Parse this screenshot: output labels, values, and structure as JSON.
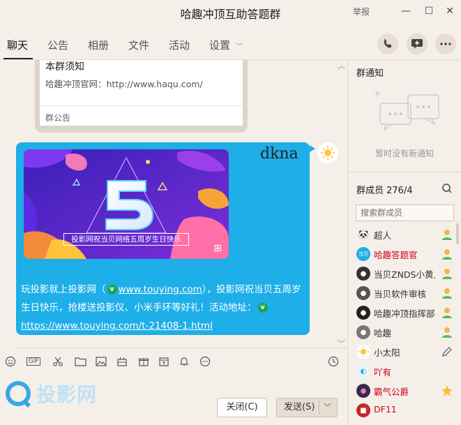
{
  "window": {
    "title": "哈趣冲顶互助答题群",
    "report_label": "举报",
    "minimize": "—",
    "maximize": "☐",
    "close": "✕"
  },
  "tabs": [
    {
      "label": "聊天",
      "active": true
    },
    {
      "label": "公告"
    },
    {
      "label": "相册"
    },
    {
      "label": "文件"
    },
    {
      "label": "活动"
    },
    {
      "label": "设置"
    }
  ],
  "header_actions": [
    "phone-icon",
    "add-chat-icon",
    "more-icon"
  ],
  "chat": {
    "notice_card": {
      "title": "本群须知",
      "line": "哈趣冲顶官网：http://www.haqu.com/",
      "footer": "群公告"
    },
    "message": {
      "sender": "dkna",
      "banner_caption": "投影网祝当贝网络五周岁生日快乐",
      "text_prefix": "玩投影就上投影网（",
      "link1": "www.touying.com",
      "text_middle": "），投影网祝当贝五周岁生日快乐，抢楼送投影仪、小米手环等好礼！活动地址：",
      "link2": "https://www.touying.com/t-21408-1.html",
      "bubble_color": "#1eaee8"
    }
  },
  "toolbar": {
    "tools": [
      "emoji-icon",
      "gif-icon",
      "scissors-icon",
      "folder-icon",
      "image-icon",
      "gift-box-icon",
      "present-icon",
      "calendar-icon",
      "bell-icon",
      "more-circle-icon",
      "history-icon"
    ],
    "gif_label": "GIF"
  },
  "watermark": "投影网",
  "buttons": {
    "close_label": "关闭(C)",
    "send_label": "发送(S)"
  },
  "sidebar": {
    "notice_title": "群通知",
    "no_notice": "暂时没有新通知",
    "members_title": "群成员 276/4",
    "search_placeholder": "搜索群成员",
    "members": [
      {
        "name": "超人",
        "color": "#222222",
        "role": "admin"
      },
      {
        "name": "哈趣答题官",
        "color": "#d0021b",
        "role": "admin"
      },
      {
        "name": "当贝ZNDS小黄人",
        "color": "#222222",
        "role": "admin"
      },
      {
        "name": "当贝软件审核",
        "color": "#222222",
        "role": "admin"
      },
      {
        "name": "哈趣冲顶指挥部",
        "color": "#222222",
        "role": "admin"
      },
      {
        "name": "哈趣",
        "color": "#222222",
        "role": "admin"
      },
      {
        "name": "小太阳",
        "color": "#222222",
        "role": "edit"
      },
      {
        "name": "吖有",
        "color": "#d0021b",
        "role": ""
      },
      {
        "name": "霸气公爵",
        "color": "#d0021b",
        "role": "star"
      },
      {
        "name": "DF11",
        "color": "#d0021b",
        "role": ""
      }
    ]
  }
}
